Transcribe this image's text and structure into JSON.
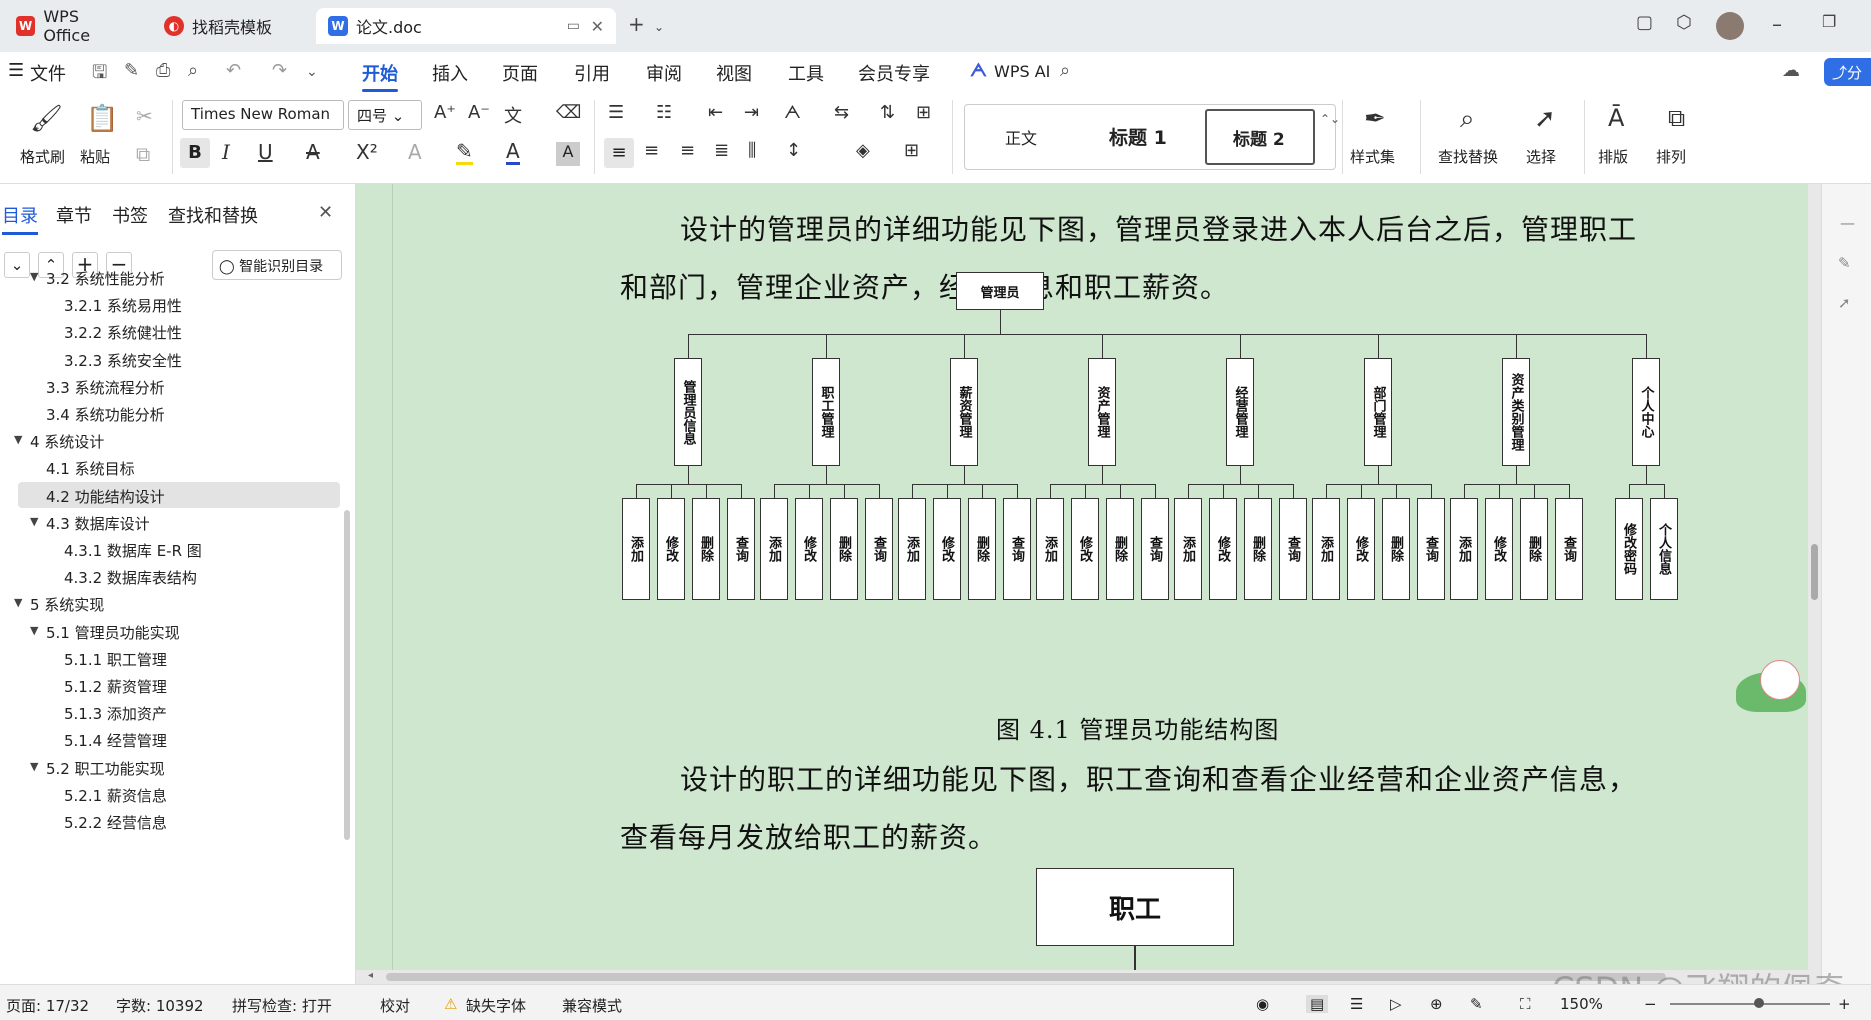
{
  "tabs": [
    {
      "label": "WPS Office"
    },
    {
      "label": "找稻壳模板"
    },
    {
      "label": "论文.doc"
    }
  ],
  "menu": {
    "file": "文件",
    "items": [
      "开始",
      "插入",
      "页面",
      "引用",
      "审阅",
      "视图",
      "工具",
      "会员专享"
    ],
    "ai": "WPS AI",
    "share": "分"
  },
  "ribbon": {
    "format_painter": "格式刷",
    "paste": "粘贴",
    "font_name": "Times New Roman",
    "font_size": "四号",
    "styles": [
      "正文",
      "标题 1",
      "标题 2"
    ],
    "style_set": "样式集",
    "find_replace": "查找替换",
    "select": "选择",
    "layout": "排版",
    "arrange": "排列"
  },
  "sidebar": {
    "tabs": [
      "目录",
      "章节",
      "书签",
      "查找和替换"
    ],
    "smart_toc": "智能识别目录",
    "items": [
      {
        "label": "3.2 系统性能分析",
        "level": 2,
        "expanded": true
      },
      {
        "label": "3.2.1 系统易用性",
        "level": 3
      },
      {
        "label": "3.2.2 系统健壮性",
        "level": 3
      },
      {
        "label": "3.2.3 系统安全性",
        "level": 3
      },
      {
        "label": "3.3  系统流程分析",
        "level": 2
      },
      {
        "label": "3.4 系统功能分析",
        "level": 2
      },
      {
        "label": "4  系统设计",
        "level": 1,
        "expanded": true
      },
      {
        "label": "4.1 系统目标",
        "level": 2
      },
      {
        "label": "4.2 功能结构设计",
        "level": 2,
        "selected": true
      },
      {
        "label": "4.3 数据库设计",
        "level": 2,
        "expanded": true
      },
      {
        "label": "4.3.1 数据库 E-R 图",
        "level": 3
      },
      {
        "label": "4.3.2  数据库表结构",
        "level": 3
      },
      {
        "label": "5  系统实现",
        "level": 1,
        "expanded": true
      },
      {
        "label": "5.1  管理员功能实现",
        "level": 2,
        "expanded": true
      },
      {
        "label": "5.1.1  职工管理",
        "level": 3
      },
      {
        "label": "5.1.2  薪资管理",
        "level": 3
      },
      {
        "label": "5.1.3  添加资产",
        "level": 3
      },
      {
        "label": "5.1.4  经营管理",
        "level": 3
      },
      {
        "label": "5.2  职工功能实现",
        "level": 2,
        "expanded": true
      },
      {
        "label": "5.2.1  薪资信息",
        "level": 3
      },
      {
        "label": "5.2.2  经营信息",
        "level": 3
      }
    ]
  },
  "document": {
    "para1_line1": "设计的管理员的详细功能见下图，管理员登录进入本人后台之后，管理职工",
    "para1_line2": "和部门，管理企业资产，经营信息和职工薪资。",
    "root": "管理员",
    "modules": [
      "管理员信息",
      "职工管理",
      "薪资管理",
      "资产管理",
      "经营管理",
      "部门管理",
      "资产类别管理",
      "个人中心"
    ],
    "ops": [
      "添加",
      "修改",
      "删除",
      "查询"
    ],
    "personal_ops": [
      "修改密码",
      "个人信息"
    ],
    "caption": "图 4.1  管理员功能结构图",
    "para2_line1": "设计的职工的详细功能见下图，职工查询和查看企业经营和企业资产信息，",
    "para2_line2": "查看每月发放给职工的薪资。",
    "root2": "职工"
  },
  "status": {
    "page": "页面: 17/32",
    "words": "字数: 10392",
    "spell": "拼写检查: 打开",
    "proof": "校对",
    "missing_font": "缺失字体",
    "compat": "兼容模式",
    "zoom": "150%"
  },
  "watermark": "CSDN @飞翔的佩奇",
  "colors": {
    "accent": "#1f5bd6",
    "doc_bg": "#cfe6cf",
    "wps_red": "#e0322b"
  }
}
